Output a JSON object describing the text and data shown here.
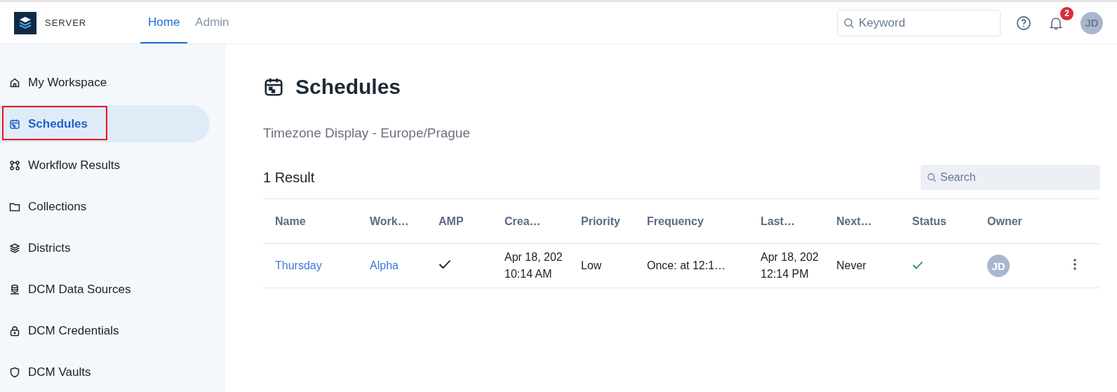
{
  "topbar": {
    "brand": "SERVER",
    "tabs": [
      {
        "label": "Home",
        "selected": true
      },
      {
        "label": "Admin",
        "selected": false
      }
    ],
    "search": {
      "placeholder": "Keyword"
    },
    "notifications": "2",
    "user_initials": "JD"
  },
  "sidebar": {
    "items": [
      {
        "label": "My Workspace",
        "selected": false,
        "highlighted": false
      },
      {
        "label": "Schedules",
        "selected": true,
        "highlighted": true
      },
      {
        "label": "Workflow Results",
        "selected": false,
        "highlighted": false
      },
      {
        "label": "Collections",
        "selected": false,
        "highlighted": false
      },
      {
        "label": "Districts",
        "selected": false,
        "highlighted": false
      },
      {
        "label": "DCM Data Sources",
        "selected": false,
        "highlighted": false
      },
      {
        "label": "DCM Credentials",
        "selected": false,
        "highlighted": false
      },
      {
        "label": "DCM Vaults",
        "selected": false,
        "highlighted": false
      }
    ]
  },
  "page": {
    "title": "Schedules",
    "subtitle": "Timezone Display - Europe/Prague",
    "result_count": "1 Result",
    "search": {
      "placeholder": "Search"
    }
  },
  "table": {
    "columns": [
      "Name",
      "Work…",
      "AMP",
      "Crea…",
      "Priority",
      "Frequency",
      "Last…",
      "Next…",
      "Status",
      "Owner"
    ],
    "rows": [
      {
        "cells": [
          {
            "kind": "link",
            "text": "Thursday"
          },
          {
            "kind": "link",
            "text": "Alpha"
          },
          {
            "kind": "check",
            "checked": true
          },
          {
            "kind": "lines",
            "lines": [
              "Apr 18, 202",
              "10:14 AM"
            ]
          },
          {
            "kind": "text",
            "text": "Low"
          },
          {
            "kind": "text",
            "text": "Once: at 12:1…"
          },
          {
            "kind": "lines",
            "lines": [
              "Apr 18, 202",
              "12:14 PM"
            ]
          },
          {
            "kind": "text",
            "text": "Never"
          },
          {
            "kind": "status",
            "succeeded": true
          },
          {
            "kind": "avatar",
            "initials": "JD"
          },
          {
            "kind": "menu"
          }
        ]
      }
    ]
  }
}
